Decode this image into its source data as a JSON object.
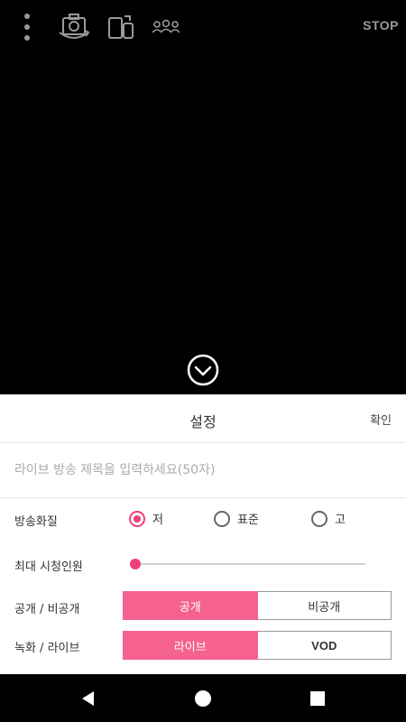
{
  "topbar": {
    "menu_icon": "more-vert-icon",
    "camera_icon": "camera-switch-icon",
    "rotate_icon": "screen-rotate-icon",
    "viewers_icon": "viewers-icon",
    "stop_label": "STOP"
  },
  "preview": {
    "collapse_icon": "chevron-down-circle-icon"
  },
  "settings": {
    "title": "설정",
    "confirm_label": "확인",
    "title_input": {
      "placeholder": "라이브 방송 제목을 입력하세요(50자)",
      "value": ""
    },
    "quality": {
      "label": "방송화질",
      "options": [
        {
          "label": "저",
          "selected": true
        },
        {
          "label": "표준",
          "selected": false
        },
        {
          "label": "고",
          "selected": false
        }
      ]
    },
    "max_viewers": {
      "label": "최대 시청인원",
      "value_fraction": 0
    },
    "visibility": {
      "label": "공개 / 비공개",
      "options": [
        "공개",
        "비공개"
      ],
      "selected": "공개"
    },
    "mode": {
      "label": "녹화 / 라이브",
      "options": [
        "라이브",
        "VOD"
      ],
      "selected": "라이브"
    }
  },
  "navbar": {
    "back_icon": "back-triangle-icon",
    "home_icon": "home-circle-icon",
    "recents_icon": "recents-square-icon"
  },
  "colors": {
    "accent": "#ef3e7d",
    "segment_active": "#f5628f",
    "background": "#000000",
    "panel": "#ffffff"
  }
}
